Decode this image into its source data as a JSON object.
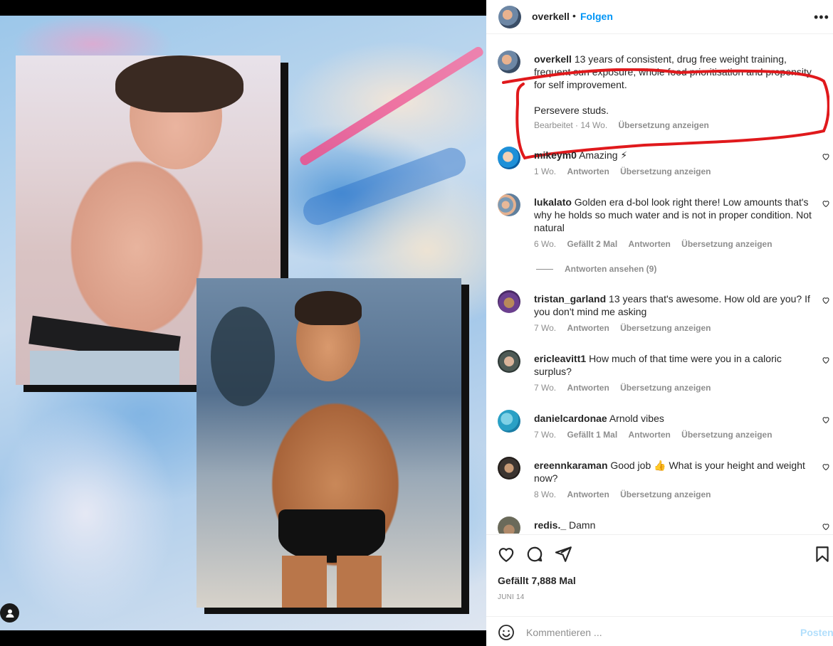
{
  "post": {
    "owner": "overkell",
    "dot": "•",
    "follow_label": "Folgen",
    "more_label": "•••"
  },
  "caption": {
    "username": "overkell",
    "text": "13 years of consistent, drug free weight training, frequent sun exposure, whole food prioritisation and propensity for self improvement.",
    "text2": "Persevere studs.",
    "meta_edited": "Bearbeitet · 14 Wo.",
    "meta_translate": "Übersetzung anzeigen"
  },
  "comments": [
    {
      "username": "mikeym0",
      "text": "Amazing ⚡",
      "age": "1 Wo.",
      "likes": "",
      "reply": "Antworten",
      "translate": "Übersetzung anzeigen"
    },
    {
      "username": "lukalato",
      "text": "Golden era d-bol look right there! Low amounts that's why he holds so much water and is not in proper condition. Not natural",
      "age": "6 Wo.",
      "likes": "Gefällt 2 Mal",
      "reply": "Antworten",
      "translate": "Übersetzung anzeigen"
    },
    {
      "username": "tristan_garland",
      "text": "13 years that's awesome. How old are you? If you don't mind me asking",
      "age": "7 Wo.",
      "likes": "",
      "reply": "Antworten",
      "translate": "Übersetzung anzeigen"
    },
    {
      "username": "ericleavitt1",
      "text": "How much of that time were you in a caloric surplus?",
      "age": "7 Wo.",
      "likes": "",
      "reply": "Antworten",
      "translate": "Übersetzung anzeigen"
    },
    {
      "username": "danielcardonae",
      "text": "Arnold vibes",
      "age": "7 Wo.",
      "likes": "Gefällt 1 Mal",
      "reply": "Antworten",
      "translate": "Übersetzung anzeigen"
    },
    {
      "username": "ereennkaraman",
      "text": "Good job 👍 What is your height and weight now?",
      "age": "8 Wo.",
      "likes": "",
      "reply": "Antworten",
      "translate": "Übersetzung anzeigen"
    },
    {
      "username": "redis._",
      "text": "Damn",
      "age": "",
      "likes": "",
      "reply": "",
      "translate": ""
    }
  ],
  "view_replies": "Antworten ansehen (9)",
  "likes_label": "Gefällt 7,888 Mal",
  "date_label": "JUNI 14",
  "composer": {
    "placeholder": "Kommentieren ...",
    "post_label": "Posten"
  },
  "colors": {
    "accent": "#0095f6",
    "annotation": "#e0191c",
    "post_disabled": "#b2dffc"
  },
  "icons": [
    "heart-icon",
    "comment-icon",
    "share-icon",
    "bookmark-icon",
    "emoji-icon",
    "user-icon",
    "more-icon"
  ]
}
